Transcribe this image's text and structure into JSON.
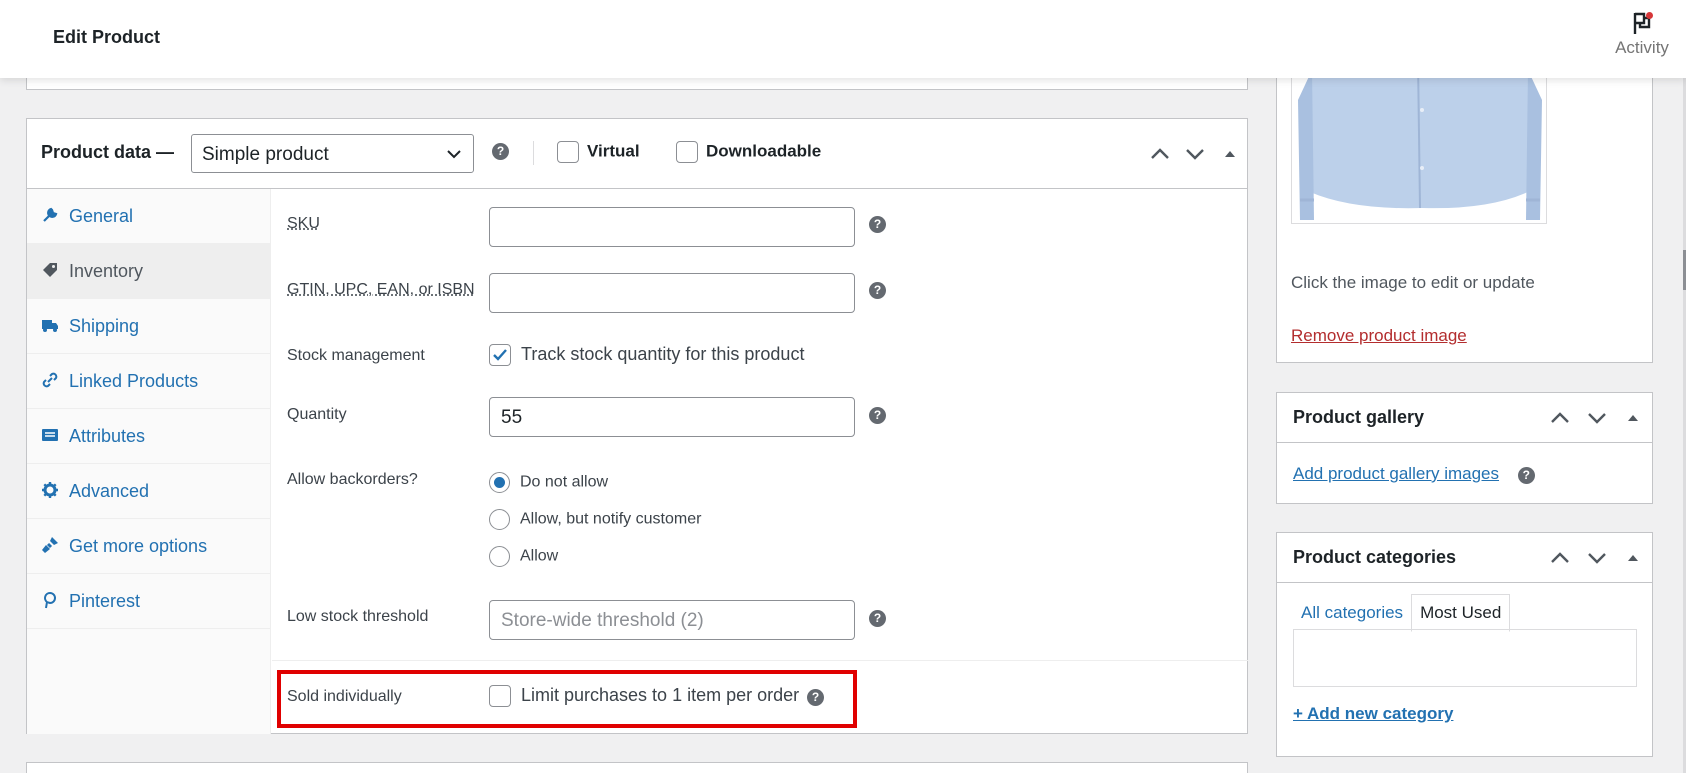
{
  "header": {
    "title": "Edit Product",
    "activity_label": "Activity"
  },
  "product_data": {
    "label": "Product data —",
    "type_select": "Simple product",
    "virtual_label": "Virtual",
    "downloadable_label": "Downloadable",
    "virtual_checked": false,
    "downloadable_checked": false
  },
  "tabs": [
    {
      "label": "General",
      "icon": "wrench-icon"
    },
    {
      "label": "Inventory",
      "icon": "tag-icon"
    },
    {
      "label": "Shipping",
      "icon": "truck-icon"
    },
    {
      "label": "Linked Products",
      "icon": "link-icon"
    },
    {
      "label": "Attributes",
      "icon": "list-icon"
    },
    {
      "label": "Advanced",
      "icon": "gear-icon"
    },
    {
      "label": "Get more options",
      "icon": "plugin-icon"
    },
    {
      "label": "Pinterest",
      "icon": "pinterest-icon"
    }
  ],
  "active_tab": "Inventory",
  "inventory": {
    "sku_label": "SKU",
    "sku_value": "",
    "gtin_label": "GTIN, UPC, EAN, or ISBN",
    "gtin_value": "",
    "stock_mgmt_label": "Stock management",
    "stock_mgmt_text": "Track stock quantity for this product",
    "stock_mgmt_checked": true,
    "quantity_label": "Quantity",
    "quantity_value": "55",
    "backorders_label": "Allow backorders?",
    "backorder_options": [
      "Do not allow",
      "Allow, but notify customer",
      "Allow"
    ],
    "backorder_selected": "Do not allow",
    "low_stock_label": "Low stock threshold",
    "low_stock_placeholder": "Store-wide threshold (2)",
    "sold_individually_label": "Sold individually",
    "sold_individually_text": "Limit purchases to 1 item per order",
    "sold_individually_checked": false
  },
  "product_image": {
    "hint": "Click the image to edit or update",
    "remove_link": "Remove product image"
  },
  "product_gallery": {
    "title": "Product gallery",
    "add_link": "Add product gallery images"
  },
  "product_categories": {
    "title": "Product categories",
    "tab_all": "All categories",
    "tab_most_used": "Most Used",
    "add_link": "+ Add new category"
  },
  "colors": {
    "link": "#2271b1",
    "highlight": "#e00000",
    "remove_link": "#b32d2e"
  }
}
